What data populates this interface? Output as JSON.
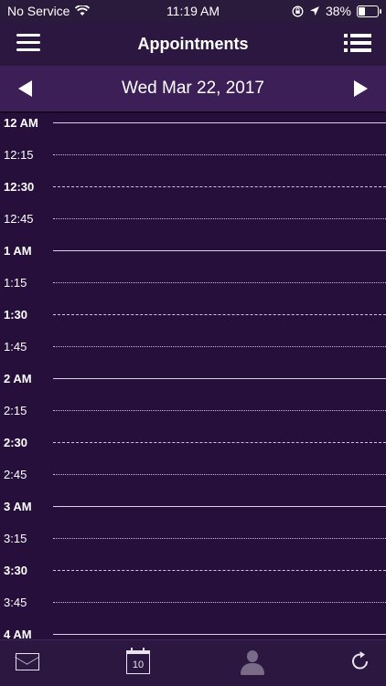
{
  "status_bar": {
    "carrier": "No Service",
    "time": "11:19 AM",
    "battery": "38%",
    "battery_level": 0.38
  },
  "nav": {
    "title": "Appointments",
    "left_icon": "hamburger-menu-icon",
    "right_icon": "list-icon"
  },
  "date_bar": {
    "date": "Wed Mar 22, 2017",
    "prev_icon": "triangle-left-icon",
    "next_icon": "triangle-right-icon"
  },
  "timeline": {
    "slots": [
      {
        "label": "12 AM",
        "style": "hour"
      },
      {
        "label": "12:15",
        "style": "quarter"
      },
      {
        "label": "12:30",
        "style": "half"
      },
      {
        "label": "12:45",
        "style": "quarter"
      },
      {
        "label": "1 AM",
        "style": "hour"
      },
      {
        "label": "1:15",
        "style": "quarter"
      },
      {
        "label": "1:30",
        "style": "half"
      },
      {
        "label": "1:45",
        "style": "quarter"
      },
      {
        "label": "2 AM",
        "style": "hour"
      },
      {
        "label": "2:15",
        "style": "quarter"
      },
      {
        "label": "2:30",
        "style": "half"
      },
      {
        "label": "2:45",
        "style": "quarter"
      },
      {
        "label": "3 AM",
        "style": "hour"
      },
      {
        "label": "3:15",
        "style": "quarter"
      },
      {
        "label": "3:30",
        "style": "half"
      },
      {
        "label": "3:45",
        "style": "quarter"
      },
      {
        "label": "4 AM",
        "style": "hour"
      }
    ]
  },
  "tab_bar": {
    "items": [
      {
        "icon": "mail-icon"
      },
      {
        "icon": "calendar-icon",
        "text": "10"
      },
      {
        "icon": "contacts-icon"
      },
      {
        "icon": "refresh-icon"
      }
    ]
  },
  "colors": {
    "background": "#260f3a",
    "nav_bar": "#2c1740",
    "date_bar": "#3b1f56"
  }
}
